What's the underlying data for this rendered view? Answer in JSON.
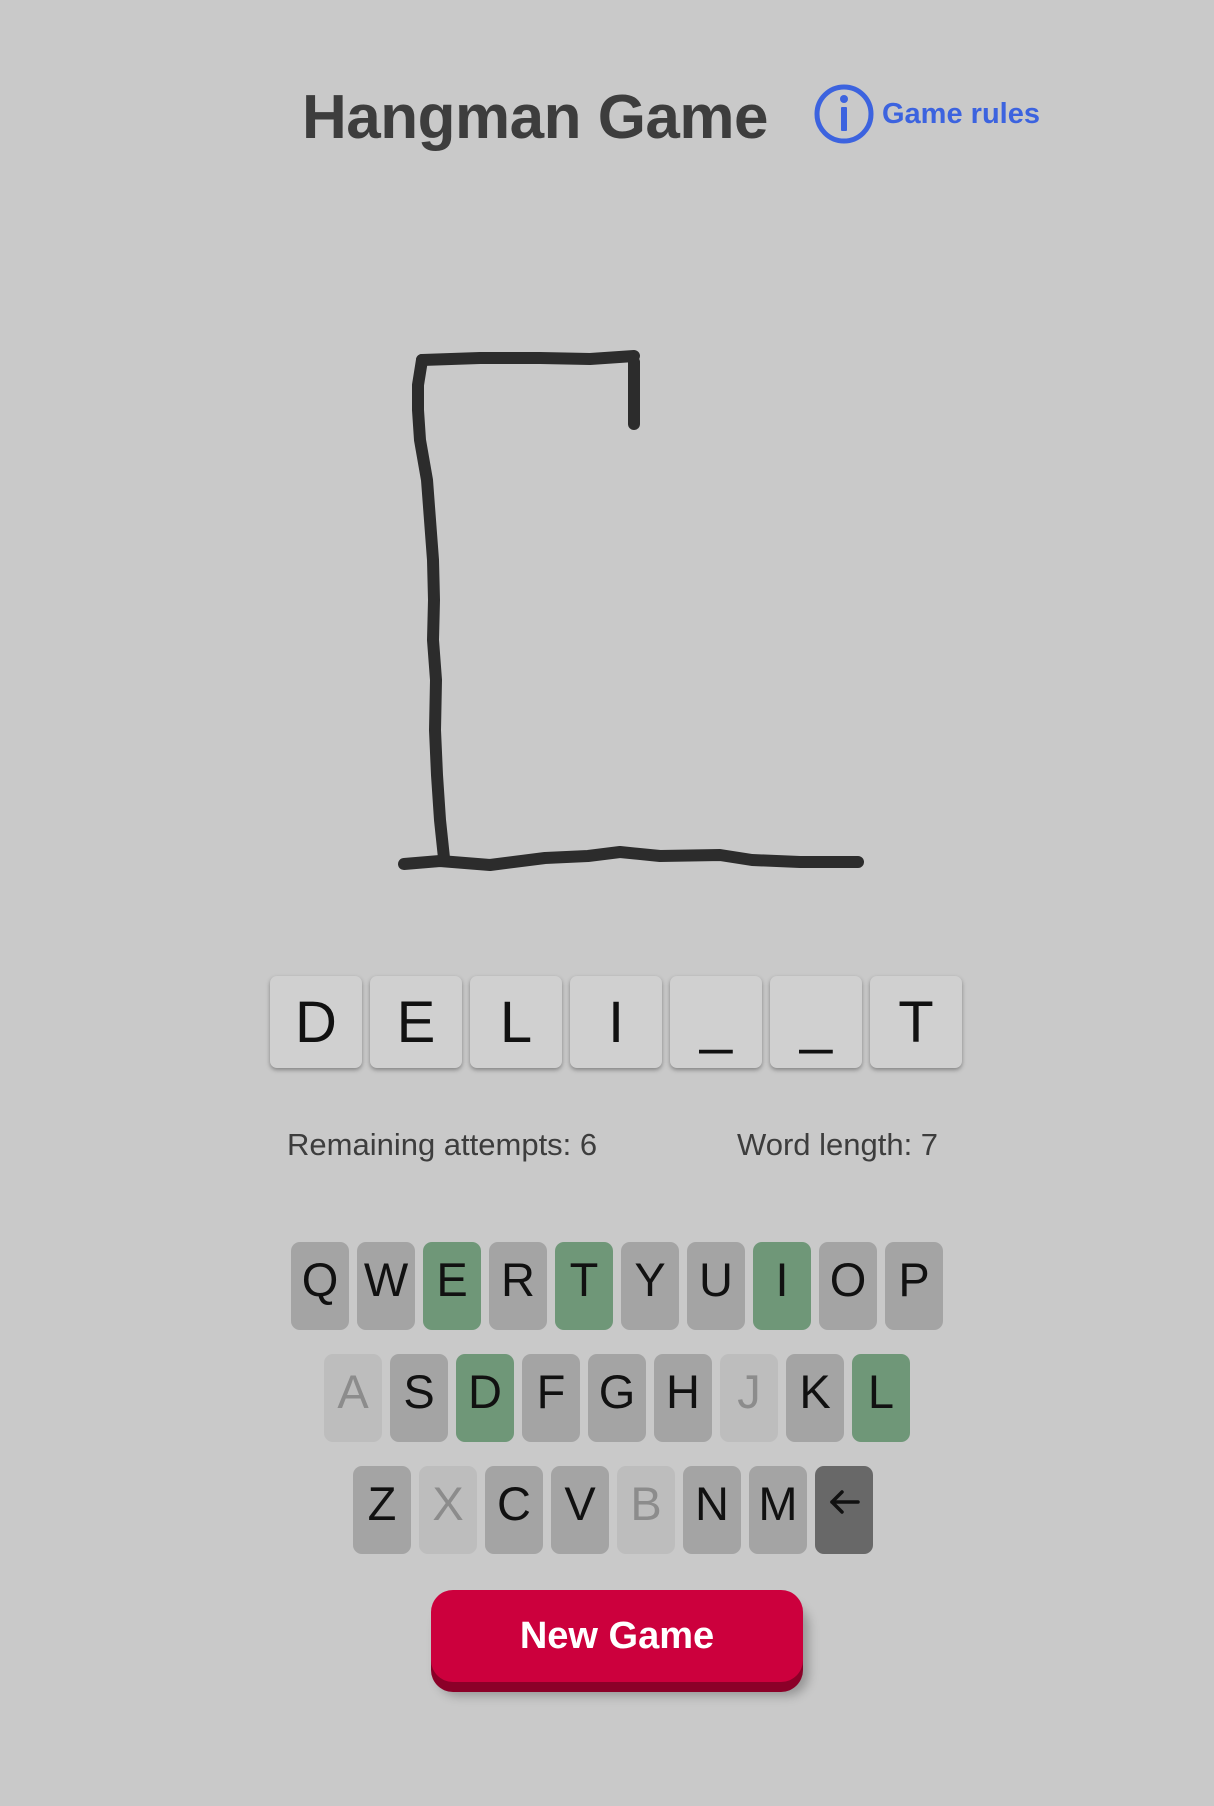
{
  "header": {
    "title": "Hangman Game",
    "rules_label": "Game rules",
    "rules_icon": "info-circle-icon"
  },
  "word": {
    "letters": [
      "D",
      "E",
      "L",
      "I",
      "_",
      "_",
      "T"
    ]
  },
  "stats": {
    "remaining_attempts": "Remaining attempts: 6",
    "word_length": "Word length: 7"
  },
  "keyboard": {
    "rows": [
      [
        {
          "letter": "Q",
          "state": "unused"
        },
        {
          "letter": "W",
          "state": "unused"
        },
        {
          "letter": "E",
          "state": "correct"
        },
        {
          "letter": "R",
          "state": "unused"
        },
        {
          "letter": "T",
          "state": "correct"
        },
        {
          "letter": "Y",
          "state": "unused"
        },
        {
          "letter": "U",
          "state": "unused"
        },
        {
          "letter": "I",
          "state": "correct"
        },
        {
          "letter": "O",
          "state": "unused"
        },
        {
          "letter": "P",
          "state": "unused"
        }
      ],
      [
        {
          "letter": "A",
          "state": "used"
        },
        {
          "letter": "S",
          "state": "unused"
        },
        {
          "letter": "D",
          "state": "correct"
        },
        {
          "letter": "F",
          "state": "unused"
        },
        {
          "letter": "G",
          "state": "unused"
        },
        {
          "letter": "H",
          "state": "unused"
        },
        {
          "letter": "J",
          "state": "used"
        },
        {
          "letter": "K",
          "state": "unused"
        },
        {
          "letter": "L",
          "state": "correct"
        }
      ],
      [
        {
          "letter": "Z",
          "state": "unused"
        },
        {
          "letter": "X",
          "state": "used"
        },
        {
          "letter": "C",
          "state": "unused"
        },
        {
          "letter": "V",
          "state": "unused"
        },
        {
          "letter": "B",
          "state": "used"
        },
        {
          "letter": "N",
          "state": "unused"
        },
        {
          "letter": "M",
          "state": "unused"
        }
      ]
    ],
    "backspace_icon": "backspace-arrow-icon"
  },
  "new_game_label": "New Game",
  "colors": {
    "background": "#c9c9c9",
    "correct_key": "#6f9778",
    "unused_key": "#a4a4a4",
    "used_key": "#bdbdbd",
    "accent_link": "#3c63df",
    "new_game_button": "#cc003d"
  }
}
